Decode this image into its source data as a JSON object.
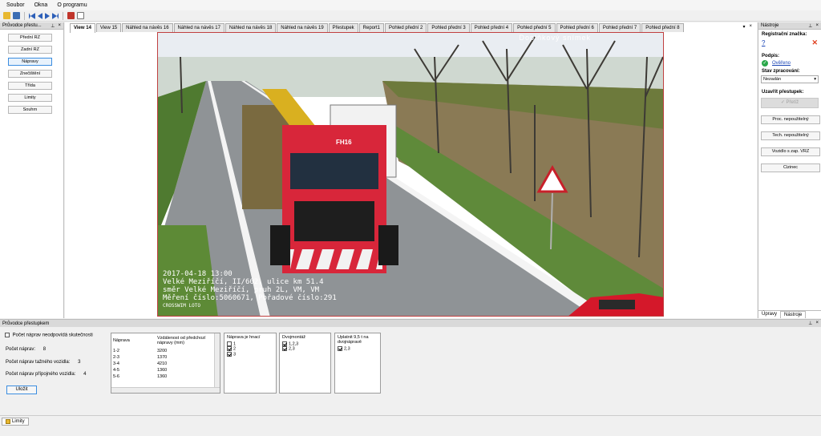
{
  "menu": [
    "Soubor",
    "Okna",
    "O programu"
  ],
  "left_panel": {
    "title": "Průvodce přestu...",
    "buttons": [
      "Přední RZ",
      "Zadní RZ",
      "Nápravy",
      "Znečištění",
      "Třída",
      "Limity",
      "Souhrn"
    ],
    "active_index": 2
  },
  "tabs": [
    "View 14",
    "View 15",
    "Náhled na návěs 16",
    "Náhled na návěs 17",
    "Náhled na návěs 18",
    "Náhled na návěs 19",
    "Přestupek",
    "Report1",
    "Pohled přední 2",
    "Pohled přední 3",
    "Pohled přední 4",
    "Pohled přední 5",
    "Pohled přední 6",
    "Pohled přední 7",
    "Pohled přední 8"
  ],
  "active_tab": 0,
  "viewer": {
    "overlay_top": "Doplňkový snímek",
    "truck_badge": "FH16",
    "overlay_lines": [
      "2017-04-18 13:00",
      "Velké Meziříčí, II/602, ulice km 51.4",
      "směr Velké Meziříčí, pruh 2L, VM, VM",
      "Měření číslo:5060671, Pořadové číslo:291",
      "CROSSWIM LOTO"
    ]
  },
  "right_panel": {
    "title": "Nástroje",
    "reg_label": "Registrační značka:",
    "reg_value": "?",
    "signature_label": "Podpis:",
    "signature_value": "Ověřeno",
    "state_label": "Stav zpracování:",
    "state_value": "Nezadán",
    "close_label": "Uzavřít přestupek:",
    "close_button": "Přetíž",
    "buttons": [
      "Proc. nepoužitelný",
      "Tech. nepoužitelný",
      "Vozidlo s zap. VRZ",
      "Cizinec"
    ],
    "bottom_tabs": [
      "Úpravy",
      "Nástroje"
    ]
  },
  "bottom_panel": {
    "title": "Průvodce přestupkem",
    "mismatch_label": "Počet náprav neodpovídá skutečnosti",
    "axles_count_label": "Počet náprav:",
    "axles_count": "8",
    "tractor_label": "Počet náprav tažného vozidla:",
    "tractor_count": "3",
    "trailer_label": "Počet náprav přípojného vozidla:",
    "trailer_count": "4",
    "save_button": "Uložit",
    "table_headers": [
      "Náprava",
      "Vzdálenost od předchozí nápravy (mm)"
    ],
    "table_rows": [
      [
        "1-2",
        "3200"
      ],
      [
        "2-3",
        "1370"
      ],
      [
        "3-4",
        "4210"
      ],
      [
        "4-5",
        "1360"
      ],
      [
        "5-6",
        "1360"
      ]
    ],
    "drive_title": "Náprava je hnací",
    "drive_items": [
      {
        "label": "1",
        "checked": false
      },
      {
        "label": "2",
        "checked": true
      },
      {
        "label": "3",
        "checked": true
      }
    ],
    "double_title": "Dvojmontáž",
    "double_items": [
      {
        "label": "1,2,3",
        "checked": true
      },
      {
        "label": "2,3",
        "checked": true
      }
    ],
    "apply_title": "Uplatnit 9,5 t na dvojnápravě",
    "apply_items": [
      {
        "label": "2,3",
        "checked": true
      }
    ]
  },
  "status_tab": "Limity"
}
